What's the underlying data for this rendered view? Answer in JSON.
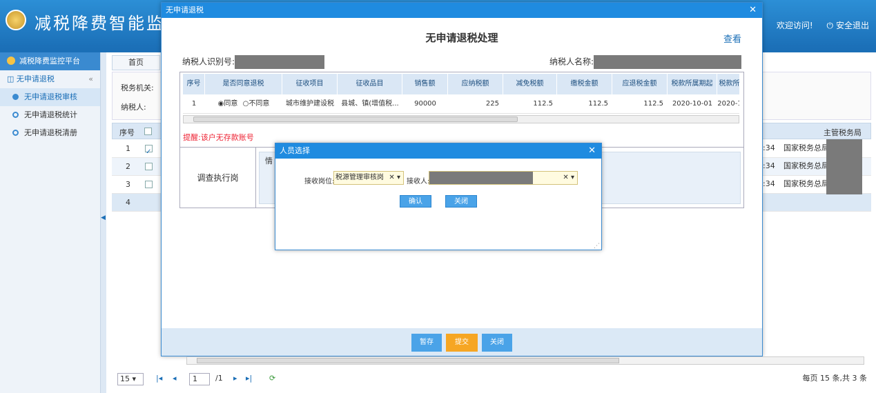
{
  "header": {
    "app_title": "减税降费智能监",
    "welcome": "欢迎访问!",
    "logout": "安全退出"
  },
  "sidebar": {
    "platform": "减税降费监控平台",
    "section": "无申请退税",
    "items": [
      {
        "label": "无申请退税审核",
        "active": true
      },
      {
        "label": "无申请退税统计",
        "active": false
      },
      {
        "label": "无申请退税清册",
        "active": false
      }
    ]
  },
  "main": {
    "tab_home": "首页",
    "filter_tax_office": "税务机关:",
    "filter_taxpayer": "纳税人:",
    "grid_head_seq": "序号",
    "grid_head_authority": "主管税务局",
    "rows": [
      {
        "seq": "1",
        "checked": true,
        "time": ":34",
        "authority": "国家税务总局"
      },
      {
        "seq": "2",
        "checked": false,
        "time": ":34",
        "authority": "国家税务总局"
      },
      {
        "seq": "3",
        "checked": false,
        "time": ":34",
        "authority": "国家税务总局"
      },
      {
        "seq": "4",
        "checked": false,
        "time": "",
        "authority": ""
      }
    ],
    "pager": {
      "page_size": "15",
      "page": "1",
      "page_total": "/1",
      "summary": "每页 15 条,共 3 条"
    }
  },
  "dialog": {
    "window_title": "无申请退税",
    "heading": "无申请退税处理",
    "view_link": "查看",
    "taxpayer_id_label": "纳税人识别号:",
    "taxpayer_name_label": "纳税人名称:",
    "table": {
      "headers": [
        "序号",
        "是否同意退税",
        "征收项目",
        "征收品目",
        "销售额",
        "应纳税额",
        "减免税额",
        "缴税金额",
        "应退税金额",
        "税款所属期起",
        "税款所"
      ],
      "row": {
        "seq": "1",
        "agree": "同意",
        "disagree": "不同意",
        "item": "城市维护建设税",
        "sub_item": "县城、镇(增值税...",
        "sales": "90000",
        "payable": "225",
        "reduction": "112.5",
        "paid": "112.5",
        "refund": "112.5",
        "period_start": "2020-10-01",
        "period_end": "2020-1"
      }
    },
    "reminder": "提醒:该户无存款账号",
    "investigation_label": "调查执行岗",
    "investigation_text": "情",
    "buttons": {
      "save": "暂存",
      "submit": "提交",
      "close": "关闭"
    }
  },
  "person_dialog": {
    "title": "人员选择",
    "post_label": "接收岗位:",
    "post_value": "税源管理审核岗",
    "receiver_label": "接收人:",
    "confirm": "确认",
    "close": "关闭"
  },
  "colors": {
    "header_blue": "#1f8be0",
    "submit_orange": "#f6a623",
    "button_blue": "#4aa3e8",
    "reminder_red": "#e23333"
  }
}
